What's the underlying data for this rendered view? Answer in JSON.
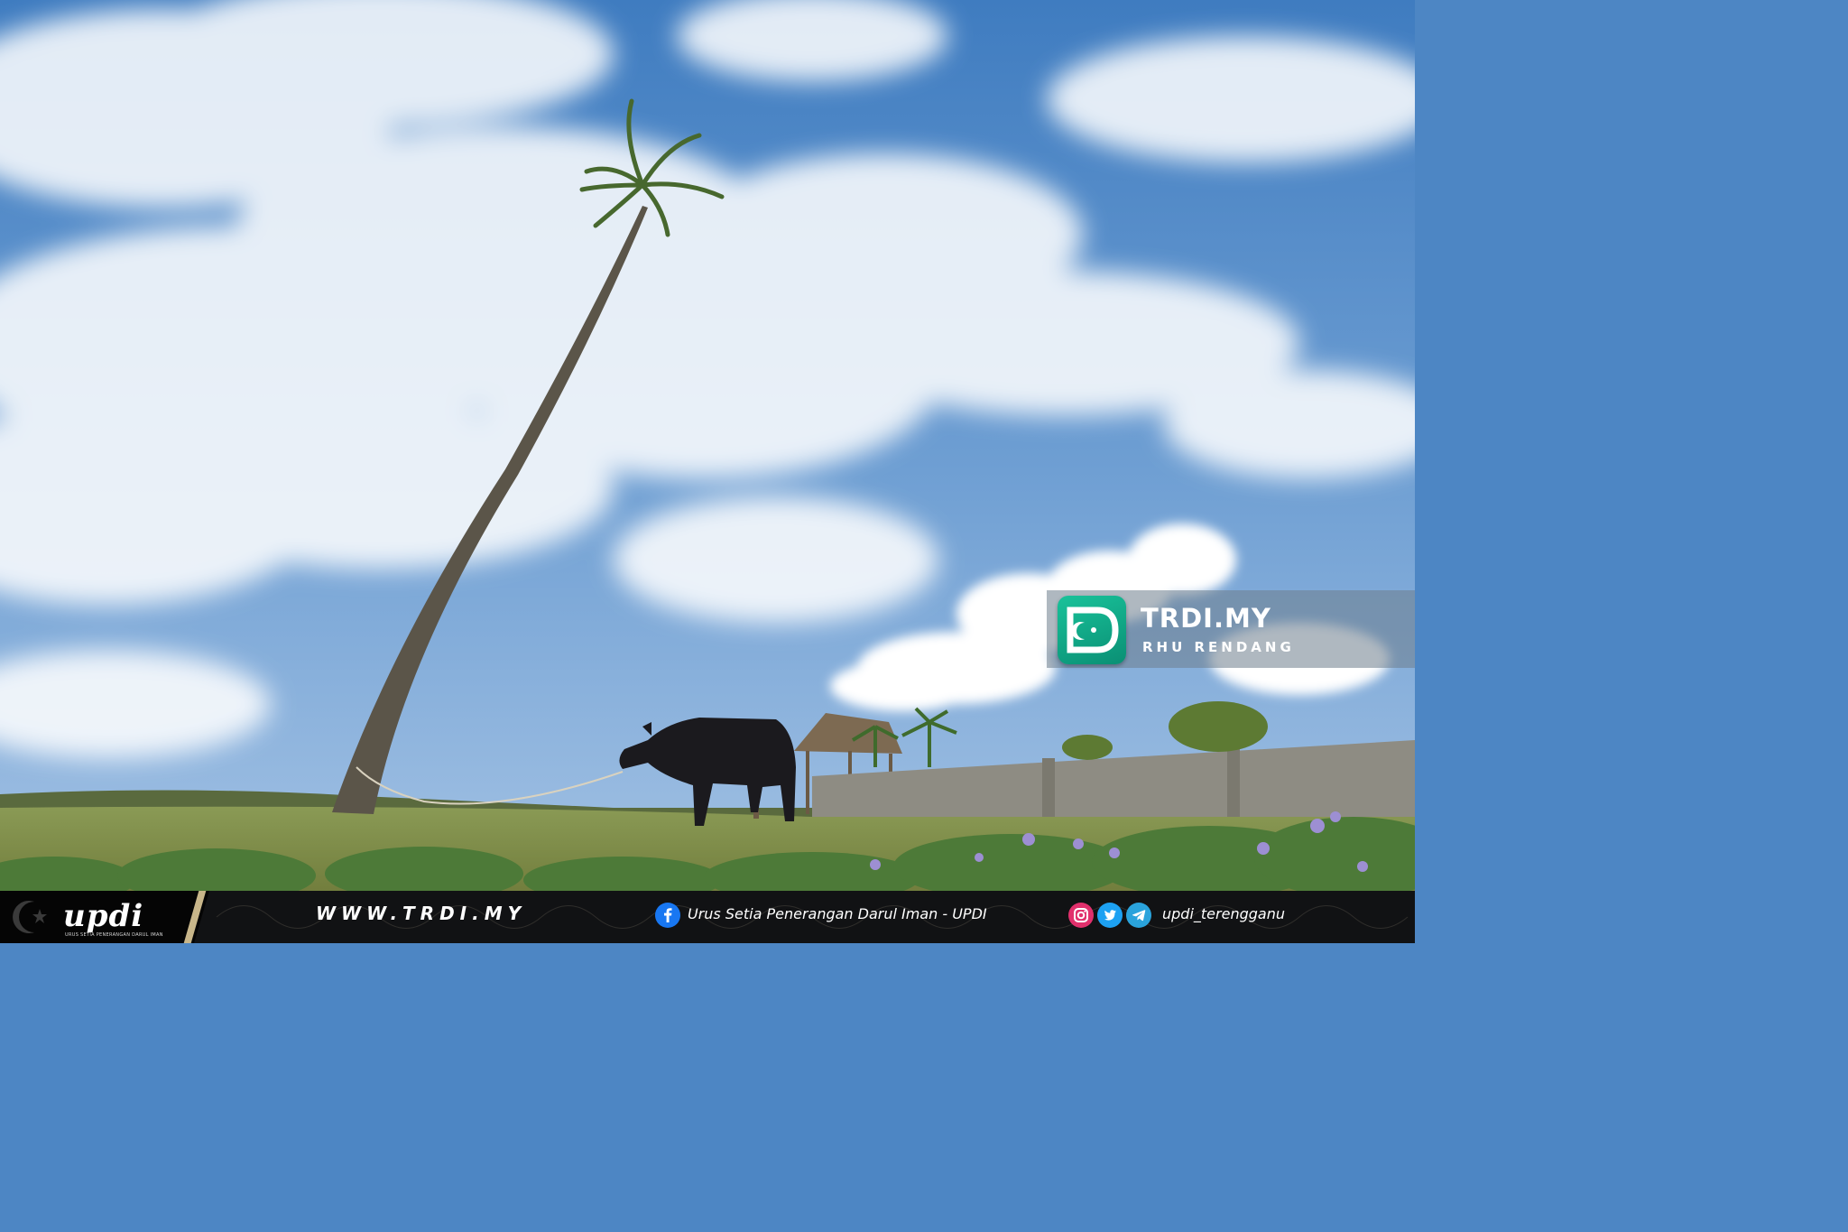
{
  "watermark": {
    "name": "TRDI.MY",
    "location": "RHU RENDANG",
    "colors": {
      "logo": "#13b08d",
      "text": "#ffffff"
    }
  },
  "footer": {
    "brand": {
      "logo_text": "updi",
      "subtitle": "URUS SETIA PENERANGAN DARUL IMAN"
    },
    "website": "WWW.TRDI.MY",
    "facebook_page": "Urus Setia Penerangan Darul Iman - UPDI",
    "social_handle": "updi_terengganu",
    "icons": [
      "facebook-icon",
      "instagram-icon",
      "twitter-icon",
      "telegram-icon"
    ],
    "colors": {
      "bar": "#111214",
      "text": "#ffffff",
      "facebook": "#1877f2",
      "instagram": "#e1306c",
      "twitter": "#1da1f2",
      "telegram": "#2aa3dc"
    }
  }
}
